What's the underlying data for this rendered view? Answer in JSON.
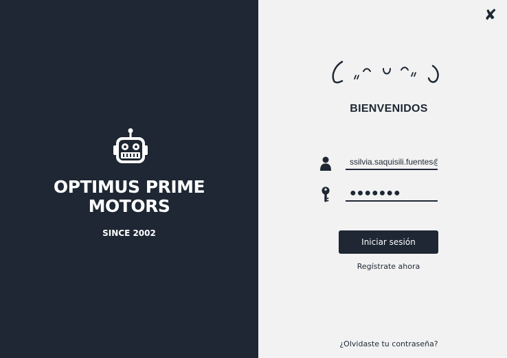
{
  "brand": {
    "line1": "OPTIMUS PRIME",
    "line2": "MOTORS",
    "since": "SINCE 2002",
    "logo_icon": "robot-icon"
  },
  "login": {
    "welcome": "BIENVENIDOS",
    "email_value": "ssilvia.saquisili.fuentes@g",
    "password_value": "●●●●●●●",
    "submit_label": "Iniciar sesión",
    "register_link": "Regístrate ahora",
    "forgot_link": "¿Olvidaste tu contraseña?",
    "user_icon": "user-icon",
    "key_icon": "key-icon",
    "close_icon": "close-icon"
  },
  "colors": {
    "dark": "#1e2733",
    "light": "#f2f2f2",
    "white": "#ffffff"
  }
}
